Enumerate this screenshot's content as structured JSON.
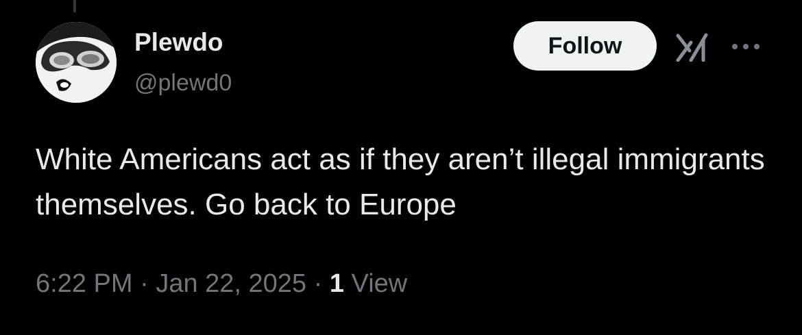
{
  "author": {
    "display_name": "Plewdo",
    "handle": "@plewd0"
  },
  "header": {
    "follow_label": "Follow",
    "grok_icon": "grok-icon",
    "more_icon": "more-options-icon"
  },
  "tweet": {
    "text": "White Americans act as if they aren’t illegal immigrants themselves. Go back to Europe",
    "time": "6:22 PM",
    "separator": "·",
    "date": "Jan 22, 2025",
    "views_count": "1",
    "views_label": "View"
  },
  "colors": {
    "background": "#000000",
    "primary_text": "#e7e9ea",
    "secondary_text": "#71767b",
    "follow_button_bg": "#eff3f4",
    "follow_button_text": "#0f1419"
  }
}
